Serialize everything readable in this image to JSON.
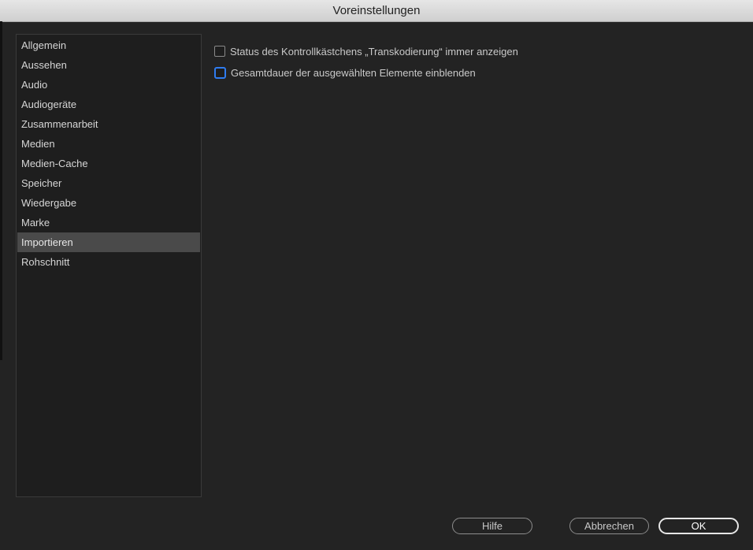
{
  "window": {
    "title": "Voreinstellungen"
  },
  "sidebar": {
    "items": [
      {
        "label": "Allgemein"
      },
      {
        "label": "Aussehen"
      },
      {
        "label": "Audio"
      },
      {
        "label": "Audiogeräte"
      },
      {
        "label": "Zusammenarbeit"
      },
      {
        "label": "Medien"
      },
      {
        "label": "Medien-Cache"
      },
      {
        "label": "Speicher"
      },
      {
        "label": "Wiedergabe"
      },
      {
        "label": "Marke"
      },
      {
        "label": "Importieren",
        "selected": true
      },
      {
        "label": "Rohschnitt"
      }
    ]
  },
  "options": {
    "transcode_status": {
      "label": "Status des Kontrollkästchens „Transkodierung“ immer anzeigen",
      "checked": false
    },
    "total_duration": {
      "label": "Gesamtdauer der ausgewählten Elemente einblenden",
      "checked": false,
      "focused": true
    }
  },
  "buttons": {
    "help": "Hilfe",
    "cancel": "Abbrechen",
    "ok": "OK"
  },
  "colors": {
    "accent_focus": "#2f7cf0",
    "selection_bg": "#4a4a4a",
    "dialog_bg": "#232323"
  }
}
